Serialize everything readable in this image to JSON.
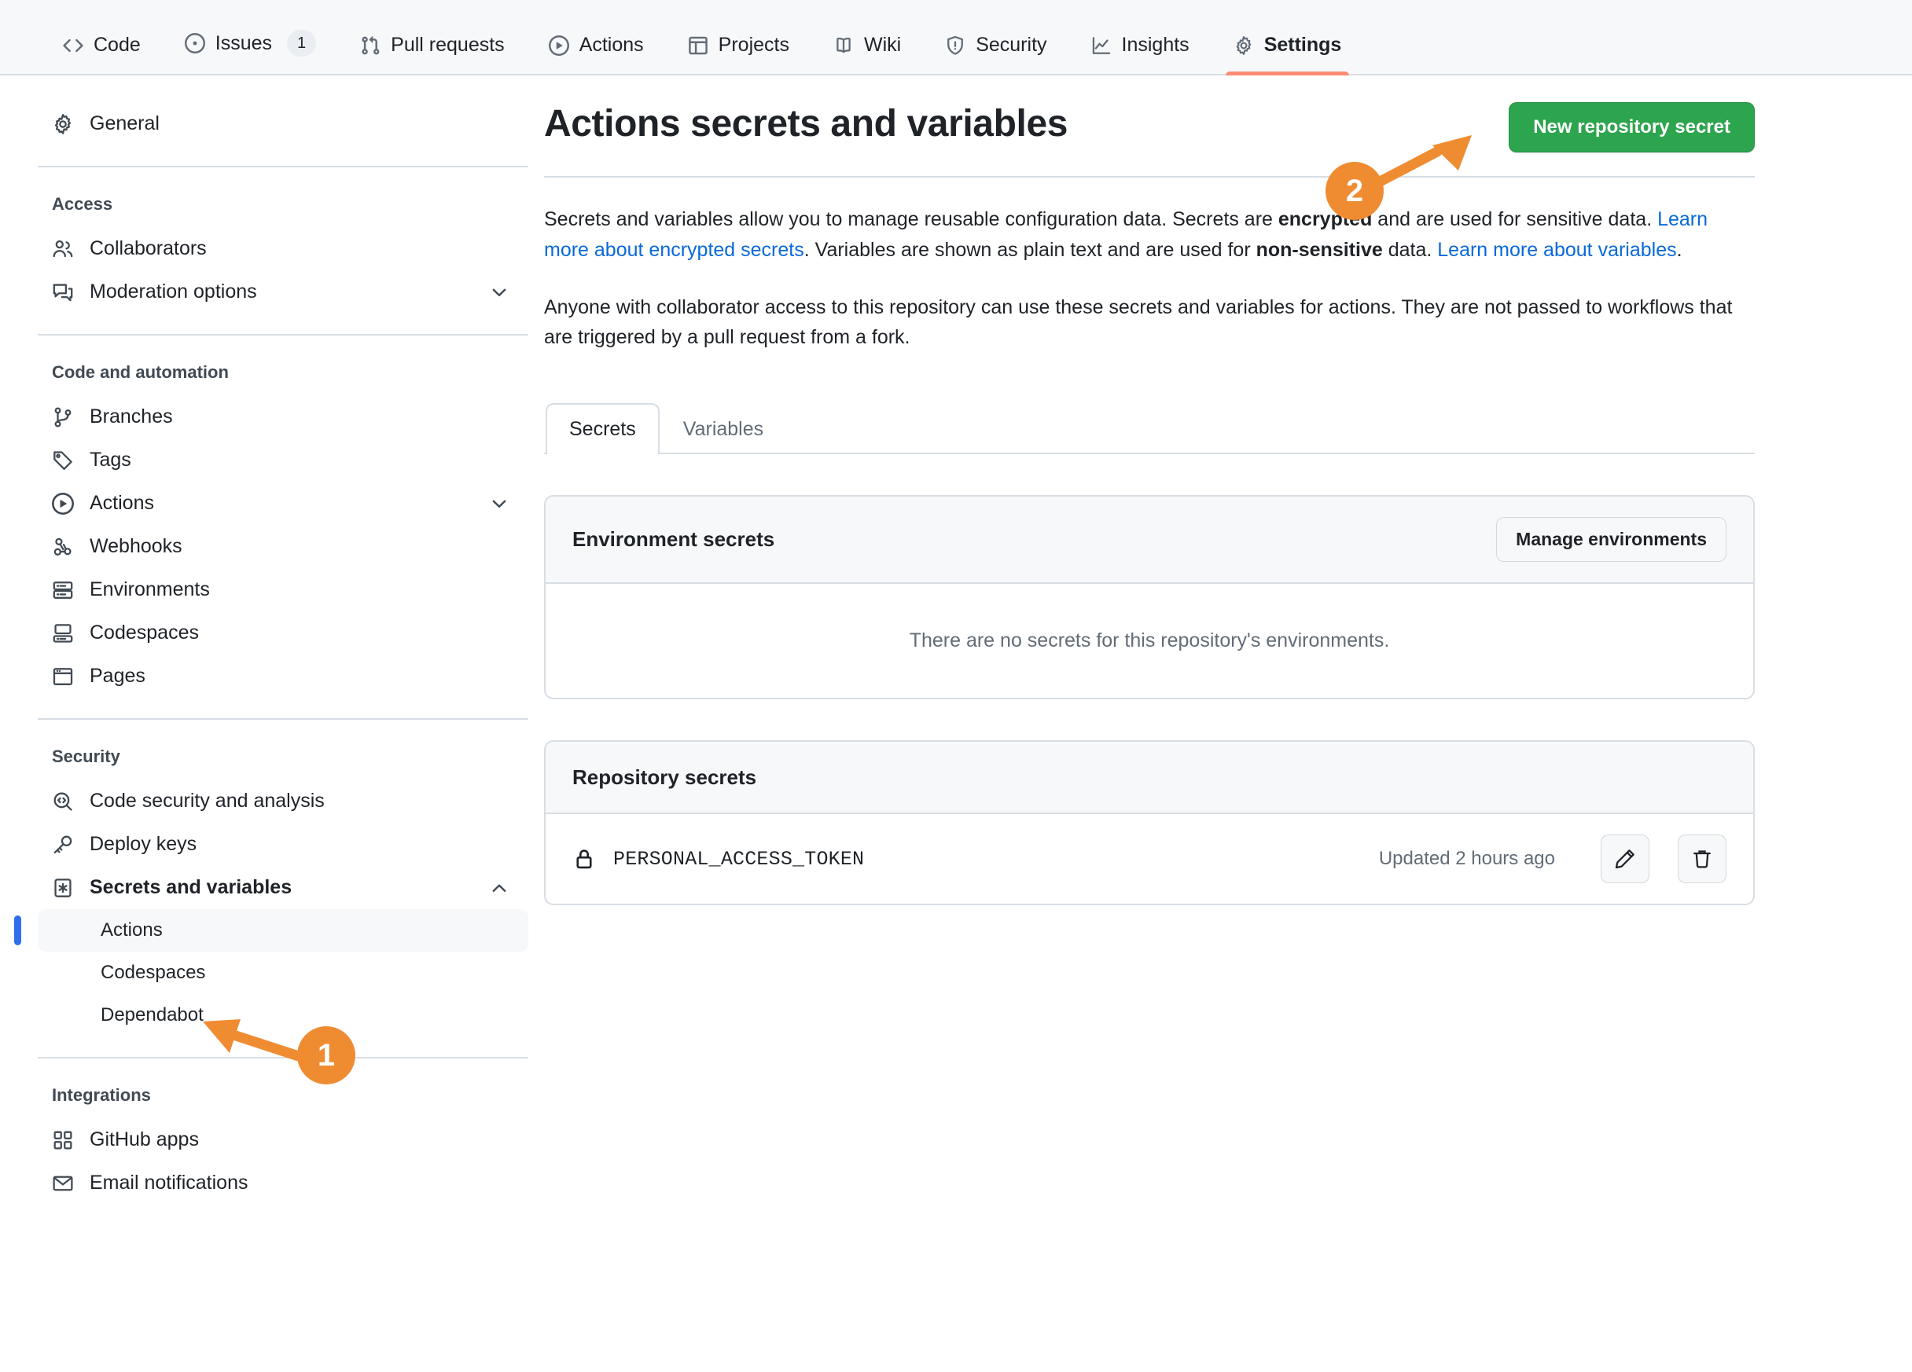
{
  "repo_nav": {
    "items": [
      {
        "label": "Code",
        "icon": "code-icon",
        "active": false
      },
      {
        "label": "Issues",
        "icon": "issue-opened-icon",
        "counter": "1",
        "active": false
      },
      {
        "label": "Pull requests",
        "icon": "git-pull-request-icon",
        "active": false
      },
      {
        "label": "Actions",
        "icon": "play-circle-icon",
        "active": false
      },
      {
        "label": "Projects",
        "icon": "table-icon",
        "active": false
      },
      {
        "label": "Wiki",
        "icon": "book-icon",
        "active": false
      },
      {
        "label": "Security",
        "icon": "shield-alert-icon",
        "active": false
      },
      {
        "label": "Insights",
        "icon": "graph-icon",
        "active": false
      },
      {
        "label": "Settings",
        "icon": "gear-icon",
        "active": true
      }
    ],
    "active_underline_color": "#fd8c73"
  },
  "sidebar": {
    "general": {
      "label": "General",
      "icon": "gear-icon"
    },
    "sections": [
      {
        "title": "Access",
        "items": [
          {
            "label": "Collaborators",
            "icon": "people-icon",
            "chevron": ""
          },
          {
            "label": "Moderation options",
            "icon": "comment-discussion-icon",
            "chevron": "down"
          }
        ]
      },
      {
        "title": "Code and automation",
        "items": [
          {
            "label": "Branches",
            "icon": "git-branch-icon",
            "chevron": ""
          },
          {
            "label": "Tags",
            "icon": "tag-icon",
            "chevron": ""
          },
          {
            "label": "Actions",
            "icon": "play-circle-icon",
            "chevron": "down"
          },
          {
            "label": "Webhooks",
            "icon": "webhook-icon",
            "chevron": ""
          },
          {
            "label": "Environments",
            "icon": "server-icon",
            "chevron": ""
          },
          {
            "label": "Codespaces",
            "icon": "codespaces-icon",
            "chevron": ""
          },
          {
            "label": "Pages",
            "icon": "browser-icon",
            "chevron": ""
          }
        ]
      },
      {
        "title": "Security",
        "items": [
          {
            "label": "Code security and analysis",
            "icon": "codescan-icon",
            "chevron": ""
          },
          {
            "label": "Deploy keys",
            "icon": "key-icon",
            "chevron": ""
          },
          {
            "label": "Secrets and variables",
            "icon": "asterisk-key-icon",
            "chevron": "up",
            "bold": true
          },
          {
            "label": "Actions",
            "sub": true,
            "selected": true
          },
          {
            "label": "Codespaces",
            "sub": true,
            "selected": false
          },
          {
            "label": "Dependabot",
            "sub": true,
            "selected": false
          }
        ]
      },
      {
        "title": "Integrations",
        "items": [
          {
            "label": "GitHub apps",
            "icon": "apps-icon",
            "chevron": ""
          },
          {
            "label": "Email notifications",
            "icon": "mail-icon",
            "chevron": ""
          }
        ]
      }
    ],
    "selected_indicator_color": "#2f6feb"
  },
  "main": {
    "title": "Actions secrets and variables",
    "new_secret_button": "New repository secret",
    "new_secret_button_color": "#2da44e",
    "paragraph1": {
      "part1": "Secrets and variables allow you to manage reusable configuration data. Secrets are ",
      "bold1": "encrypted",
      "part2": " and are used for sensitive data. ",
      "link1": "Learn more about encrypted secrets",
      "part3": ". Variables are shown as plain text and are used for ",
      "bold2": "non-sensitive",
      "part4": " data. ",
      "link2": "Learn more about variables",
      "part5": "."
    },
    "paragraph2": "Anyone with collaborator access to this repository can use these secrets and variables for actions. They are not passed to workflows that are triggered by a pull request from a fork.",
    "tabs": [
      {
        "label": "Secrets",
        "active": true
      },
      {
        "label": "Variables",
        "active": false
      }
    ],
    "environment_secrets": {
      "title": "Environment secrets",
      "manage_button": "Manage environments",
      "empty_message": "There are no secrets for this repository's environments."
    },
    "repository_secrets": {
      "title": "Repository secrets",
      "rows": [
        {
          "icon": "lock-icon",
          "name": "PERSONAL_ACCESS_TOKEN",
          "updated": "Updated 2 hours ago",
          "edit_icon": "pencil-icon",
          "delete_icon": "trash-icon"
        }
      ]
    }
  },
  "annotations": {
    "color": "#ef8c32",
    "markers": [
      {
        "number": "1",
        "target": "sidebar-actions-secrets-item"
      },
      {
        "number": "2",
        "target": "new-repository-secret-button"
      }
    ]
  }
}
